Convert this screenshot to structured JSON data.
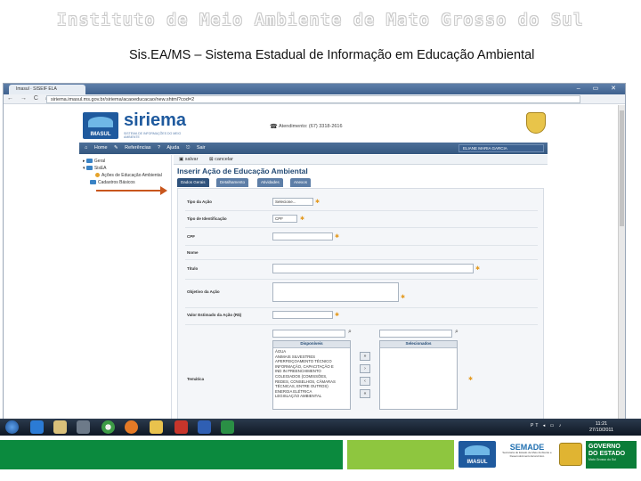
{
  "slide": {
    "institute_title": "Instituto de Meio Ambiente de Mato Grosso do Sul",
    "subtitle": "Sis.EA/MS – Sistema Estadual de Informação em Educação Ambiental"
  },
  "browser": {
    "tab_label": "Imasul · SISEIF ELA",
    "url": "siriema.imasul.ms.gov.br/siriema/acaoeducacao/new.shtml?cod=2",
    "window_buttons": "– ▭ ✕",
    "nav": "← → C ⌂"
  },
  "app": {
    "brand": "siriema",
    "brand_sub": "SISTEMA DE INFORMAÇÕES DO MEIO AMBIENTE",
    "logo_label": "IMASUL",
    "phone": "Atendimento: (67) 3318-2616",
    "menu": "⌂ Home   ✎ Referências   ? Ajuda   ⎋ Sair",
    "user": "ELIANE MARIA GARCIA",
    "tree": {
      "n1": "Geral",
      "n2": "SisEA",
      "n3": "Ações de Educação Ambiental",
      "n4": "Cadastros Básicos"
    },
    "toolbar": {
      "save": "salvar",
      "cancel": "cancelar"
    },
    "page_title": "Inserir Ação de Educação Ambiental",
    "tabs": [
      "Dados Gerais",
      "Detalhamento",
      "Atividades",
      "Anexos"
    ],
    "form": {
      "tipo_acao_label": "Tipo da Ação",
      "tipo_acao_value": "Selecione...",
      "tipo_ident_label": "Tipo de Identificação",
      "tipo_ident_value": "CPF",
      "cpf_label": "CPF",
      "nome_label": "Nome",
      "titulo_label": "Título",
      "objetivo_label": "Objetivo da Ação",
      "valor_label": "Valor Estimado da Ação (R$)",
      "tematica_label": "Temática",
      "search_glyph": "⌕",
      "list_available_head": "Disponíveis",
      "list_selected_head": "Selecionados",
      "available_items": [
        "ÁGUA",
        "ANIMAIS SILVESTRES",
        "APERFEIÇOAMENTO TÉCNICO",
        "INFORMAÇÃO, CAPACITAÇÃO E",
        "IND IN PREENCHIMENTO",
        "COLEGIADOS (COMISSÕES,",
        "REDES, CONSELHOS, CÂMARAS",
        "TÉCNICAS, ENTRE OUTROS)",
        "ENERGIA ELÉTRICA",
        "LEGISLAÇÃO AMBIENTAL"
      ],
      "move_buttons": [
        "»",
        "›",
        "‹",
        "«"
      ]
    }
  },
  "taskbar": {
    "tray": "PT ◂ ▭ ♪",
    "time": "11:21",
    "date": "27/10/2011"
  },
  "footer": {
    "imasul": "IMASUL",
    "semade": "SEMADE",
    "semade_desc": "Secretaria de Estado de Meio Ambiente e Desenvolvimento Econômico",
    "gov_line1": "GOVERNO",
    "gov_line2": "DO ESTADO",
    "gov_state": "Mato Grosso do Sul"
  },
  "colors": {
    "imasul_blue": "#1f5a9e",
    "footer_dark_green": "#0b8a3e",
    "footer_light_green": "#8ec63f",
    "arrow": "#c8561d"
  }
}
